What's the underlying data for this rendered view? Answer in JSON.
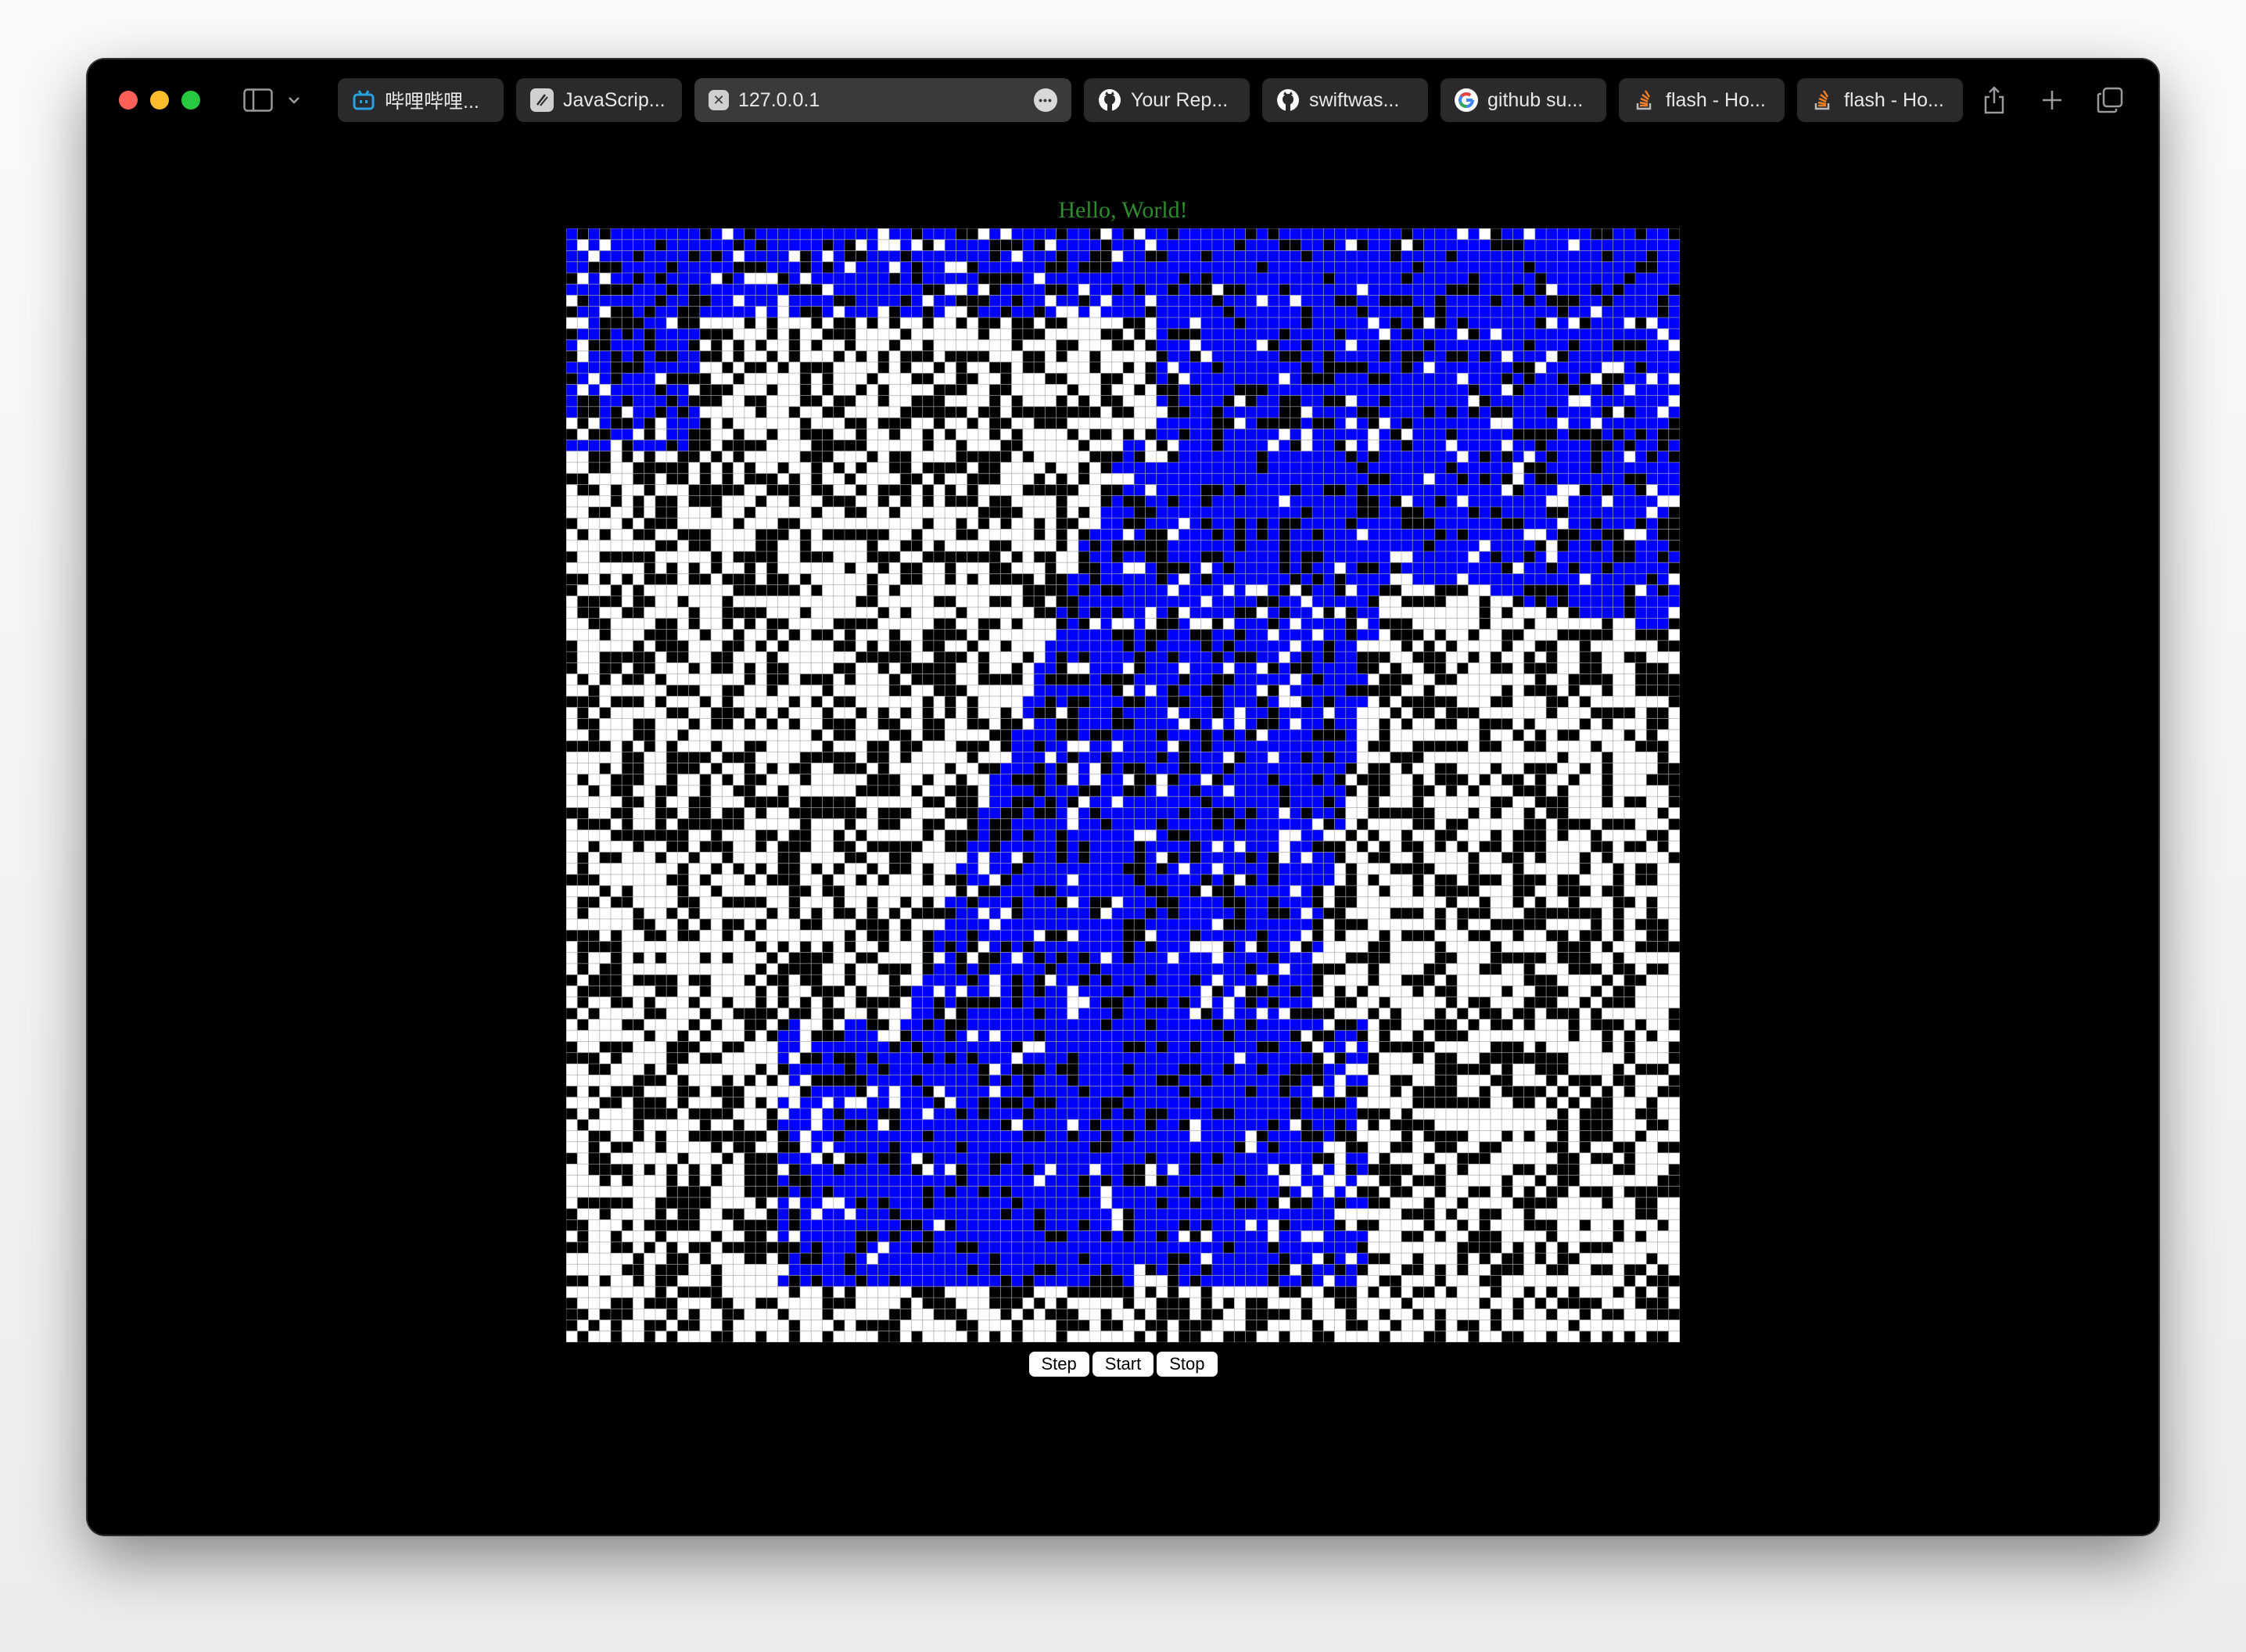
{
  "browser": {
    "tabs": [
      {
        "title": "哔哩哔哩...",
        "favicon": "bilibili-icon",
        "color": "#2aa0e0",
        "active": false
      },
      {
        "title": "JavaScrip...",
        "favicon": "book-icon",
        "color": "#d0d0d2",
        "active": false
      },
      {
        "title": "127.0.0.1",
        "favicon": "close-square-icon",
        "color": "#d0d0d2",
        "active": true
      },
      {
        "title": "Your Rep...",
        "favicon": "github-icon",
        "color": "#ffffff",
        "active": false
      },
      {
        "title": "swiftwas...",
        "favicon": "github-icon",
        "color": "#ffffff",
        "active": false
      },
      {
        "title": "github su...",
        "favicon": "google-icon",
        "color": "#ffffff",
        "active": false
      },
      {
        "title": "flash - Ho...",
        "favicon": "stackoverflow-icon",
        "color": "#f48024",
        "active": false
      },
      {
        "title": "flash - Ho...",
        "favicon": "stackoverflow-icon",
        "color": "#f48024",
        "active": false
      }
    ]
  },
  "page": {
    "heading": "Hello, World!",
    "buttons": {
      "step": "Step",
      "start": "Start",
      "stop": "Stop"
    },
    "grid": {
      "rows": 100,
      "cols": 100,
      "colors": {
        "alive": "#ffffff",
        "dead": "#000000",
        "flooded": "#0000ff",
        "gridline": "#9a9a9a"
      }
    }
  }
}
